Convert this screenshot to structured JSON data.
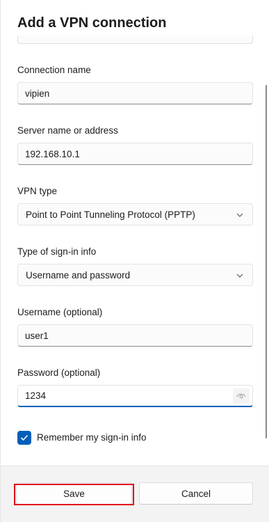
{
  "dialog": {
    "title": "Add a VPN connection"
  },
  "form": {
    "connection_name": {
      "label": "Connection name",
      "value": "vipien"
    },
    "server": {
      "label": "Server name or address",
      "value": "192.168.10.1"
    },
    "vpn_type": {
      "label": "VPN type",
      "selected": "Point to Point Tunneling Protocol (PPTP)"
    },
    "sign_in_type": {
      "label": "Type of sign-in info",
      "selected": "Username and password"
    },
    "username": {
      "label": "Username (optional)",
      "value": "user1"
    },
    "password": {
      "label": "Password (optional)",
      "value": "1234"
    },
    "remember": {
      "label": "Remember my sign-in info",
      "checked": true
    }
  },
  "footer": {
    "save_label": "Save",
    "cancel_label": "Cancel"
  },
  "colors": {
    "accent": "#005fb8",
    "highlight": "#e0001b"
  },
  "icons": [
    "chevron-down-icon",
    "eye-icon",
    "checkmark-icon"
  ]
}
